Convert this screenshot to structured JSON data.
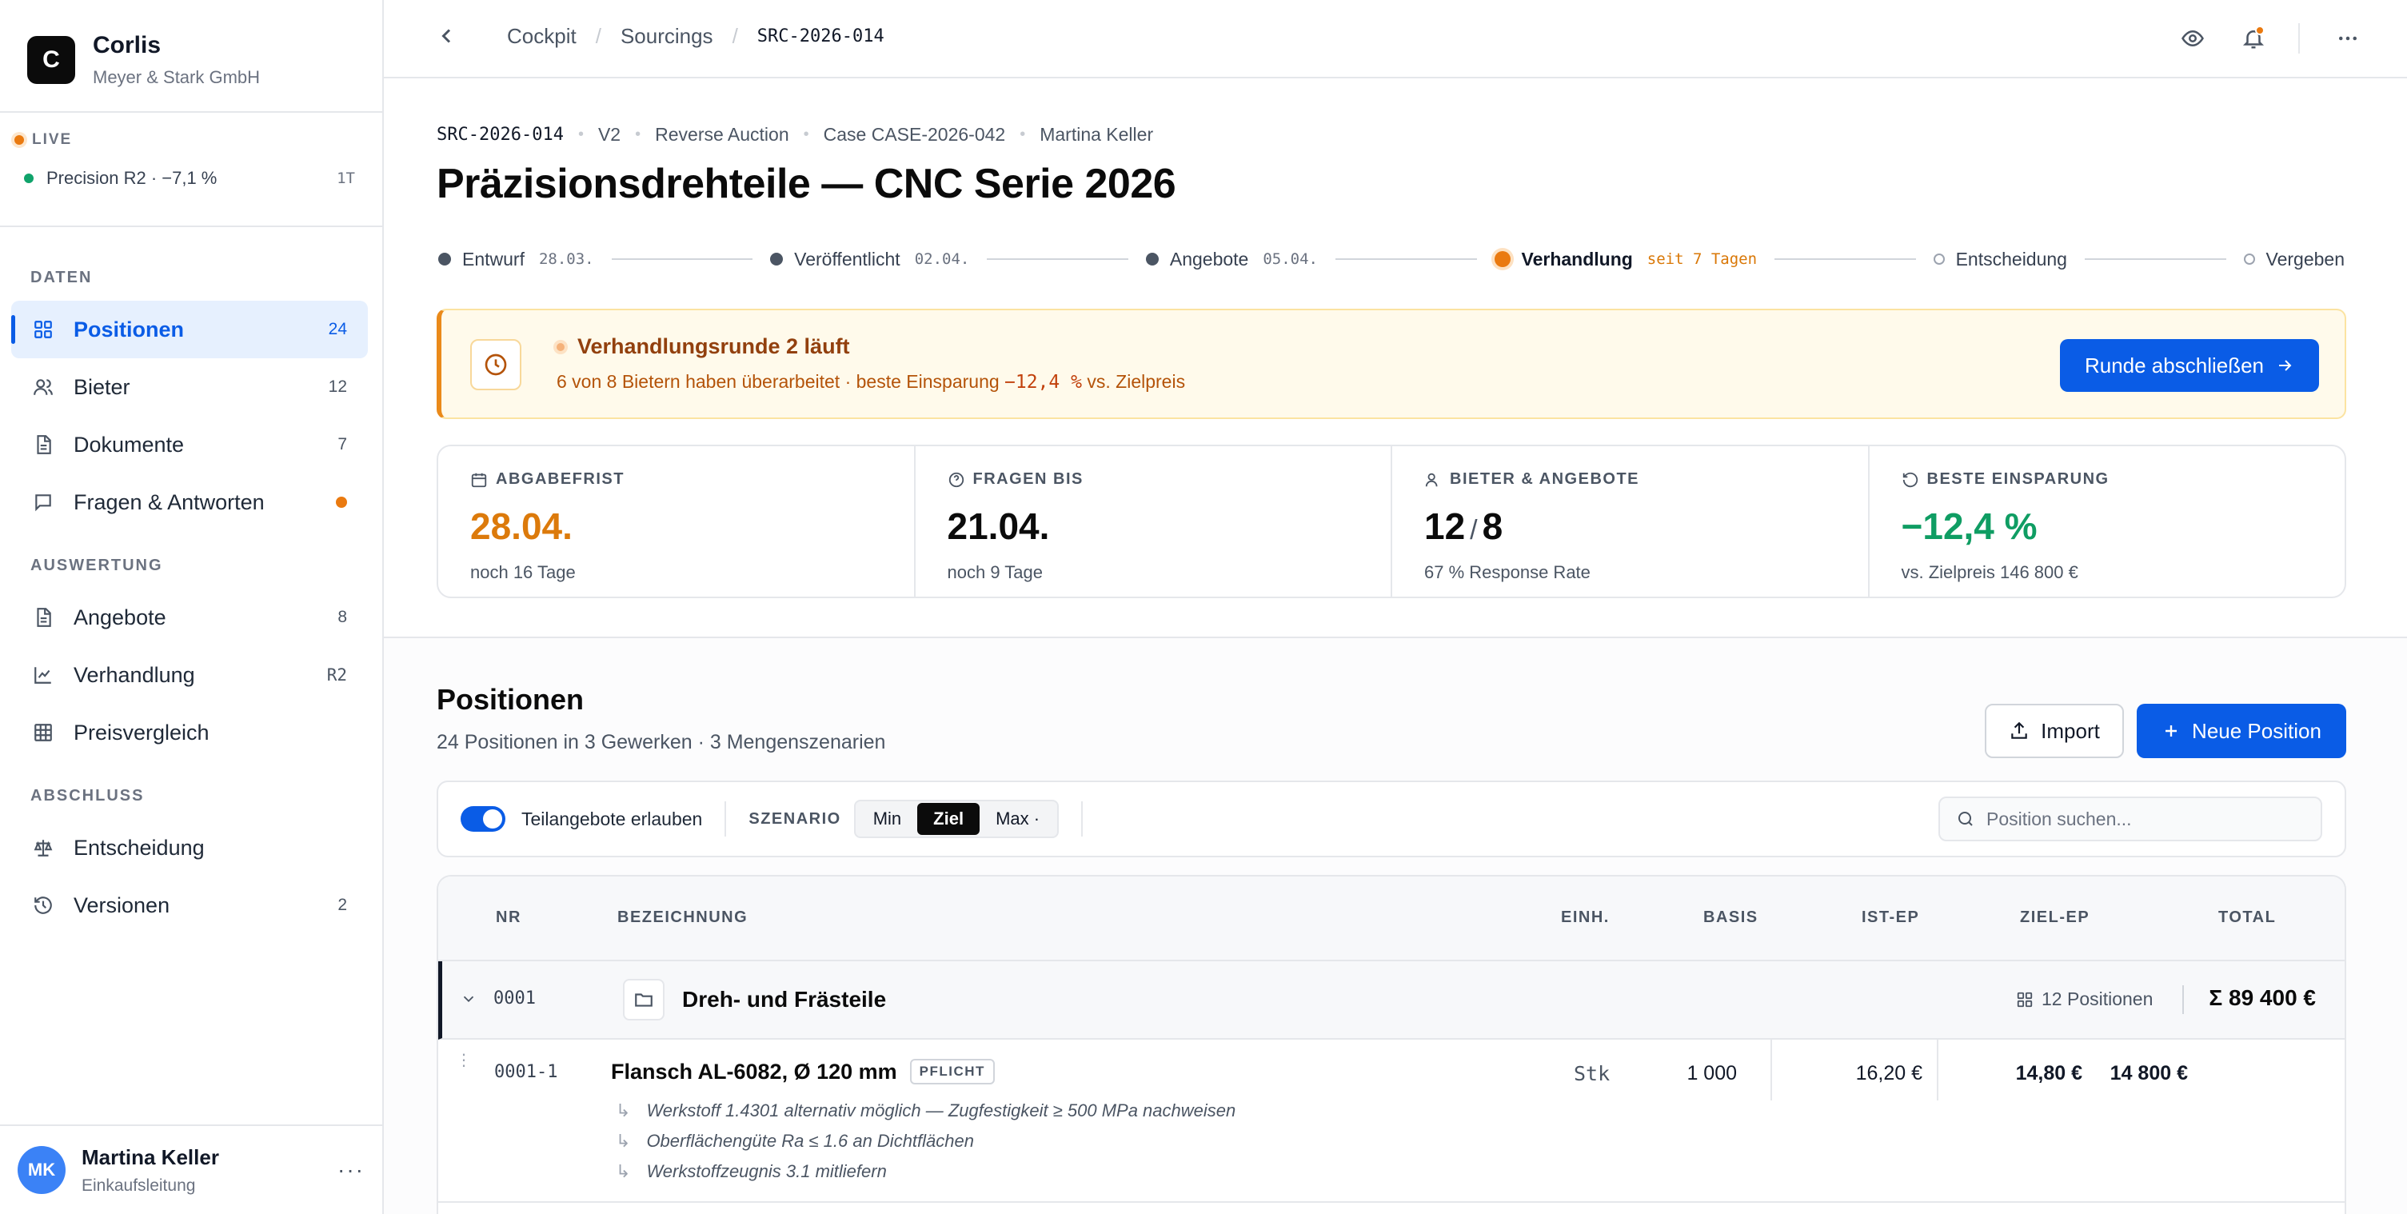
{
  "brand": {
    "initial": "C",
    "name": "Corlis",
    "company": "Meyer & Stark GmbH"
  },
  "live": {
    "label": "LIVE",
    "item": "Precision R2 · −7,1 %",
    "badge": "1T"
  },
  "nav": {
    "sections": {
      "daten": "DATEN",
      "auswertung": "AUSWERTUNG",
      "abschluss": "ABSCHLUSS"
    },
    "items": [
      {
        "label": "Positionen",
        "count": "24"
      },
      {
        "label": "Bieter",
        "count": "12"
      },
      {
        "label": "Dokumente",
        "count": "7"
      },
      {
        "label": "Fragen & Antworten",
        "count": ""
      },
      {
        "label": "Angebote",
        "count": "8"
      },
      {
        "label": "Verhandlung",
        "count": "R2"
      },
      {
        "label": "Preisvergleich",
        "count": ""
      },
      {
        "label": "Entscheidung",
        "count": ""
      },
      {
        "label": "Versionen",
        "count": "2"
      }
    ]
  },
  "user": {
    "initials": "MK",
    "name": "Martina Keller",
    "role": "Einkaufsleitung"
  },
  "breadcrumb": {
    "items": [
      "Cockpit",
      "Sourcings"
    ],
    "current": "SRC-2026-014"
  },
  "meta": {
    "code": "SRC-2026-014",
    "version": "V2",
    "type": "Reverse Auction",
    "case": "Case CASE-2026-042",
    "owner": "Martina Keller"
  },
  "title": "Präzisionsdrehteile — CNC Serie 2026",
  "steps": [
    {
      "label": "Entwurf",
      "date": "28.03."
    },
    {
      "label": "Veröffentlicht",
      "date": "02.04."
    },
    {
      "label": "Angebote",
      "date": "05.04."
    },
    {
      "label": "Verhandlung",
      "date": "seit 7 Tagen"
    },
    {
      "label": "Entscheidung",
      "date": ""
    },
    {
      "label": "Vergeben",
      "date": ""
    }
  ],
  "banner": {
    "title": "Verhandlungsrunde 2 läuft",
    "sub_before": "6 von 8 Bietern haben überarbeitet · beste Einsparung",
    "sub_value": "−12,4 %",
    "sub_after": "vs. Zielpreis",
    "button": "Runde abschließen"
  },
  "stats": [
    {
      "label": "ABGABEFRIST",
      "value": "28.04.",
      "sub": "noch 16 Tage"
    },
    {
      "label": "FRAGEN BIS",
      "value": "21.04.",
      "sub": "noch 9 Tage"
    },
    {
      "label": "BIETER & ANGEBOTE",
      "value_a": "12",
      "slash": "/",
      "value_b": "8",
      "sub": "67 % Response Rate"
    },
    {
      "label": "BESTE EINSPARUNG",
      "value": "−12,4 %",
      "sub": "vs. Zielpreis 146 800 €"
    }
  ],
  "positions": {
    "title": "Positionen",
    "subtitle": "24 Positionen in 3 Gewerken · 3 Mengenszenarien",
    "import_label": "Import",
    "new_label": "Neue Position"
  },
  "toolbar": {
    "toggle_label": "Teilangebote erlauben",
    "scenario_label": "SZENARIO",
    "scenarios": [
      "Min",
      "Ziel",
      "Max ·"
    ],
    "search_placeholder": "Position suchen..."
  },
  "table": {
    "headers": {
      "nr": "NR",
      "bez": "BEZEICHNUNG",
      "einh": "EINH.",
      "basis": "BASIS",
      "ist": "IST-EP",
      "ziel": "ZIEL-EP",
      "total": "TOTAL"
    },
    "group": {
      "nr": "0001",
      "title": "Dreh- und Frästeile",
      "count": "12 Positionen",
      "total": "Σ 89 400 €"
    },
    "item": {
      "nr": "0001-1",
      "title": "Flansch AL-6082, Ø 120 mm",
      "badge": "PFLICHT",
      "unit": "Stk",
      "basis": "1 000",
      "ist": "16,20 €",
      "ziel": "14,80 €",
      "total": "14 800 €",
      "notes": [
        "Werkstoff 1.4301 alternativ möglich — Zugfestigkeit ≥ 500 MPa nachweisen",
        "Oberflächengüte Ra ≤ 1.6 an Dichtflächen",
        "Werkstoffzeugnis 3.1 mitliefern"
      ]
    }
  }
}
